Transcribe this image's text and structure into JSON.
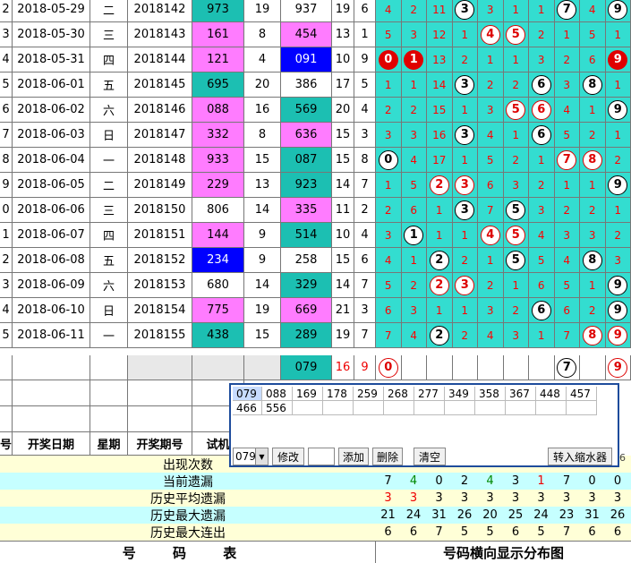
{
  "rows": [
    {
      "idx": "2",
      "date": "2018-05-29",
      "wd": "二",
      "period": "2018142",
      "trial": "973",
      "s1": "19",
      "num": "937",
      "s2": "19",
      "sp": "6",
      "tc": "t",
      "nc": "w",
      "d": [
        "4",
        "2",
        "11",
        "3",
        "3",
        "1",
        "1",
        "7",
        "4",
        "9"
      ],
      "mk": {
        "3": "w",
        "7": "w",
        "9": "w"
      }
    },
    {
      "idx": "3",
      "date": "2018-05-30",
      "wd": "三",
      "period": "2018143",
      "trial": "161",
      "s1": "8",
      "num": "454",
      "s2": "13",
      "sp": "1",
      "tc": "m",
      "nc": "m",
      "d": [
        "5",
        "3",
        "12",
        "1",
        "4",
        "5",
        "2",
        "1",
        "5",
        "1"
      ],
      "mk": {
        "4": "r",
        "5": "r"
      }
    },
    {
      "idx": "4",
      "date": "2018-05-31",
      "wd": "四",
      "period": "2018144",
      "trial": "121",
      "s1": "4",
      "num": "091",
      "s2": "10",
      "sp": "9",
      "tc": "m",
      "nc": "b",
      "d": [
        "0",
        "1",
        "13",
        "2",
        "1",
        "1",
        "3",
        "2",
        "6",
        "9"
      ],
      "mk": {
        "0": "f",
        "1": "f",
        "9": "f"
      }
    },
    {
      "idx": "5",
      "date": "2018-06-01",
      "wd": "五",
      "period": "2018145",
      "trial": "695",
      "s1": "20",
      "num": "386",
      "s2": "17",
      "sp": "5",
      "tc": "t",
      "nc": "w",
      "d": [
        "1",
        "1",
        "14",
        "3",
        "2",
        "2",
        "6",
        "3",
        "8",
        "1"
      ],
      "mk": {
        "3": "w",
        "6": "w",
        "8": "w"
      }
    },
    {
      "idx": "6",
      "date": "2018-06-02",
      "wd": "六",
      "period": "2018146",
      "trial": "088",
      "s1": "16",
      "num": "569",
      "s2": "20",
      "sp": "4",
      "tc": "m",
      "nc": "t",
      "d": [
        "2",
        "2",
        "15",
        "1",
        "3",
        "5",
        "6",
        "4",
        "1",
        "9"
      ],
      "mk": {
        "5": "r",
        "6": "r",
        "9": "w"
      }
    },
    {
      "idx": "7",
      "date": "2018-06-03",
      "wd": "日",
      "period": "2018147",
      "trial": "332",
      "s1": "8",
      "num": "636",
      "s2": "15",
      "sp": "3",
      "tc": "m",
      "nc": "m",
      "d": [
        "3",
        "3",
        "16",
        "3",
        "4",
        "1",
        "6",
        "5",
        "2",
        "1"
      ],
      "mk": {
        "3": "w",
        "6": "w"
      }
    },
    {
      "idx": "8",
      "date": "2018-06-04",
      "wd": "一",
      "period": "2018148",
      "trial": "933",
      "s1": "15",
      "num": "087",
      "s2": "15",
      "sp": "8",
      "tc": "m",
      "nc": "t",
      "d": [
        "0",
        "4",
        "17",
        "1",
        "5",
        "2",
        "1",
        "7",
        "8",
        "2"
      ],
      "mk": {
        "0": "w",
        "7": "r",
        "8": "r"
      }
    },
    {
      "idx": "9",
      "date": "2018-06-05",
      "wd": "二",
      "period": "2018149",
      "trial": "229",
      "s1": "13",
      "num": "923",
      "s2": "14",
      "sp": "7",
      "tc": "m",
      "nc": "t",
      "d": [
        "1",
        "5",
        "2",
        "3",
        "6",
        "3",
        "2",
        "1",
        "1",
        "9"
      ],
      "mk": {
        "2": "r",
        "3": "r",
        "9": "w"
      }
    },
    {
      "idx": "0",
      "date": "2018-06-06",
      "wd": "三",
      "period": "2018150",
      "trial": "806",
      "s1": "14",
      "num": "335",
      "s2": "11",
      "sp": "2",
      "tc": "w",
      "nc": "m",
      "d": [
        "2",
        "6",
        "1",
        "3",
        "7",
        "5",
        "3",
        "2",
        "2",
        "1"
      ],
      "mk": {
        "3": "w",
        "5": "w"
      }
    },
    {
      "idx": "1",
      "date": "2018-06-07",
      "wd": "四",
      "period": "2018151",
      "trial": "144",
      "s1": "9",
      "num": "514",
      "s2": "10",
      "sp": "4",
      "tc": "m",
      "nc": "t",
      "d": [
        "3",
        "1",
        "1",
        "1",
        "4",
        "5",
        "4",
        "3",
        "3",
        "2"
      ],
      "mk": {
        "1": "w",
        "4": "r",
        "5": "r"
      }
    },
    {
      "idx": "2",
      "date": "2018-06-08",
      "wd": "五",
      "period": "2018152",
      "trial": "234",
      "s1": "9",
      "num": "258",
      "s2": "15",
      "sp": "6",
      "tc": "b",
      "nc": "w",
      "d": [
        "4",
        "1",
        "2",
        "2",
        "1",
        "5",
        "5",
        "4",
        "8",
        "3"
      ],
      "mk": {
        "2": "w",
        "5": "w",
        "8": "w"
      }
    },
    {
      "idx": "3",
      "date": "2018-06-09",
      "wd": "六",
      "period": "2018153",
      "trial": "680",
      "s1": "14",
      "num": "329",
      "s2": "14",
      "sp": "7",
      "tc": "w",
      "nc": "t",
      "d": [
        "5",
        "2",
        "2",
        "3",
        "2",
        "1",
        "6",
        "5",
        "1",
        "9"
      ],
      "mk": {
        "2": "r",
        "3": "r",
        "9": "w"
      }
    },
    {
      "idx": "4",
      "date": "2018-06-10",
      "wd": "日",
      "period": "2018154",
      "trial": "775",
      "s1": "19",
      "num": "669",
      "s2": "21",
      "sp": "3",
      "tc": "m",
      "nc": "m",
      "d": [
        "6",
        "3",
        "1",
        "1",
        "3",
        "2",
        "6",
        "6",
        "2",
        "9"
      ],
      "mk": {
        "6": "w",
        "9": "w"
      }
    },
    {
      "idx": "5",
      "date": "2018-06-11",
      "wd": "一",
      "period": "2018155",
      "trial": "438",
      "s1": "15",
      "num": "289",
      "s2": "19",
      "sp": "7",
      "tc": "t",
      "nc": "t",
      "d": [
        "7",
        "4",
        "2",
        "2",
        "4",
        "3",
        "1",
        "7",
        "8",
        "9"
      ],
      "mk": {
        "2": "w",
        "8": "r",
        "9": "r"
      }
    }
  ],
  "predict": {
    "num": "079",
    "s2": "16",
    "sp": "9",
    "d": [
      "0",
      "",
      "",
      "",
      "",
      "",
      "",
      "7",
      "",
      "9"
    ],
    "mk": {
      "0": "br",
      "7": "bw",
      "9": "br"
    }
  },
  "header": {
    "idx": "号",
    "date": "开奖日期",
    "wd": "星期",
    "period": "开奖期号",
    "trial": "试机"
  },
  "popup": {
    "row1": [
      "079",
      "088",
      "169",
      "178",
      "259",
      "268",
      "277",
      "349",
      "358",
      "367",
      "448",
      "457"
    ],
    "row2": [
      "466",
      "556"
    ],
    "select_value": "079",
    "edit_label": "修改",
    "add_label": "添加",
    "delete_label": "删除",
    "clear_label": "清空",
    "transfer_label": "转入缩水器",
    "right_edge_value": "6"
  },
  "stats": [
    {
      "label": "出现次数",
      "values": [],
      "bg": "#ffffd7"
    },
    {
      "label": "当前遗漏",
      "values": [
        "7",
        "4",
        "0",
        "2",
        "4",
        "3",
        "1",
        "7",
        "0",
        "0"
      ],
      "colors": [
        "#000",
        "#080",
        "#000",
        "#000",
        "#080",
        "#000",
        "#e00",
        "#000",
        "#000",
        "#000"
      ],
      "bg": "#c6ffff"
    },
    {
      "label": "历史平均遗漏",
      "values": [
        "3",
        "3",
        "3",
        "3",
        "3",
        "3",
        "3",
        "3",
        "3",
        "3"
      ],
      "colors": [
        "#e00",
        "#e00",
        "#000",
        "#000",
        "#000",
        "#000",
        "#000",
        "#000",
        "#000",
        "#000"
      ],
      "bg": "#ffffd7"
    },
    {
      "label": "历史最大遗漏",
      "values": [
        "21",
        "24",
        "31",
        "26",
        "20",
        "25",
        "24",
        "23",
        "31",
        "26"
      ],
      "bg": "#c6ffff"
    },
    {
      "label": "历史最大连出",
      "values": [
        "6",
        "6",
        "7",
        "5",
        "5",
        "6",
        "5",
        "7",
        "6",
        "6"
      ],
      "bg": "#ffffd7"
    }
  ],
  "footer": {
    "left": "号 码 表",
    "right": "号码横向显示分布图"
  },
  "colors": {
    "teal": "#1cbfb2",
    "magenta": "#ff7cff",
    "blue": "#0000ff",
    "dist": "#33ddd0"
  }
}
